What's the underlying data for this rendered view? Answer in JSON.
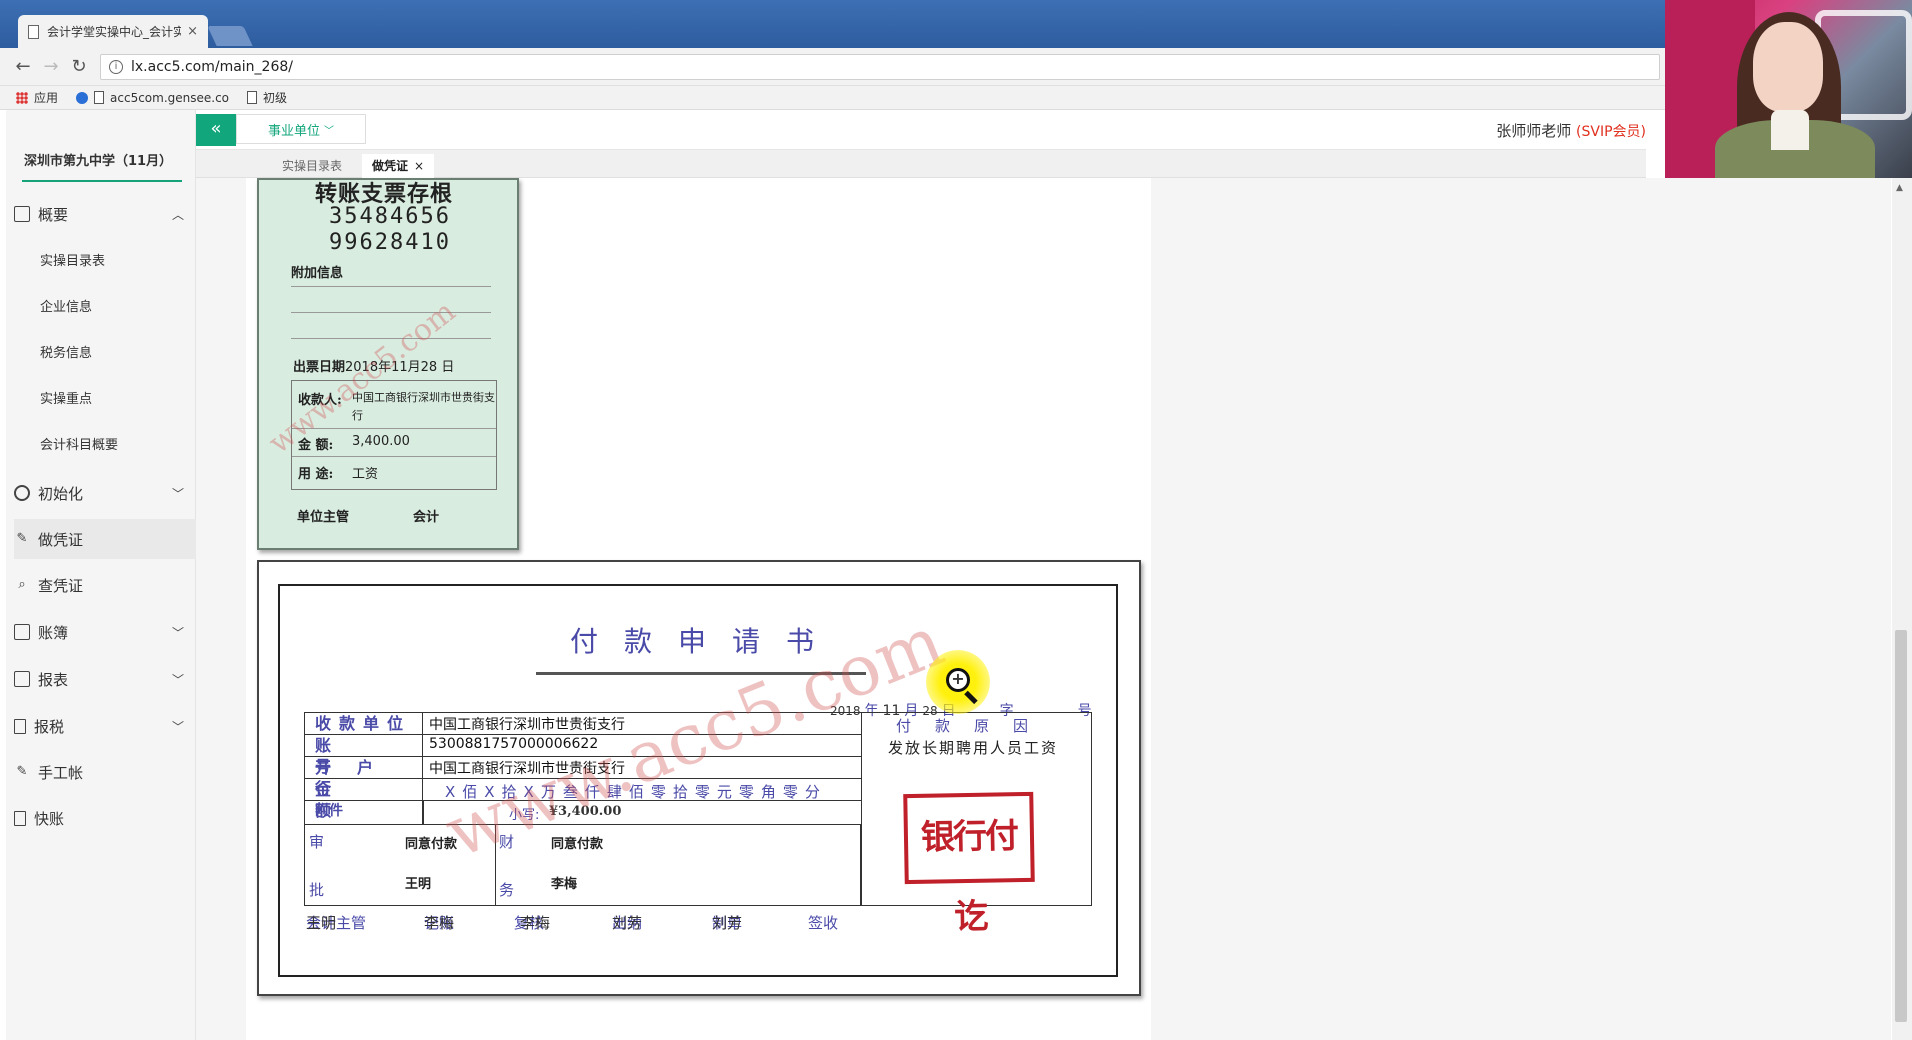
{
  "browser": {
    "tab_title": "会计学堂实操中心_会计实",
    "url": "lx.acc5.com/main_268/",
    "bookmarks": [
      "应用",
      "acc5com.gensee.co",
      "初级"
    ]
  },
  "app": {
    "unit_select": "事业单位",
    "user_name": "张师师老师",
    "user_badge": "(SVIP会员)",
    "tabs": [
      {
        "label": "实操目录表",
        "active": false
      },
      {
        "label": "做凭证",
        "active": true
      }
    ]
  },
  "sidebar": {
    "school": "深圳市第九中学（11月）",
    "menu": [
      {
        "label": "概要",
        "icon": "grid-icon",
        "expanded": true
      },
      {
        "label": "初始化",
        "icon": "gear-icon",
        "expanded": false
      },
      {
        "label": "做凭证",
        "icon": "pencil-icon",
        "active": true
      },
      {
        "label": "查凭证",
        "icon": "search-icon"
      },
      {
        "label": "账簿",
        "icon": "ledger-icon",
        "expanded": false
      },
      {
        "label": "报表",
        "icon": "report-icon",
        "expanded": false
      },
      {
        "label": "报税",
        "icon": "document-icon",
        "expanded": false
      },
      {
        "label": "手工帐",
        "icon": "pencil-icon"
      },
      {
        "label": "快账",
        "icon": "document-icon"
      }
    ],
    "submenu": [
      "实操目录表",
      "企业信息",
      "税务信息",
      "实操重点",
      "会计科目概要"
    ]
  },
  "stub": {
    "title": "转账支票存根",
    "numbers": [
      "35484656",
      "99628410"
    ],
    "extra_info_label": "附加信息",
    "issue_date_label": "出票日期",
    "issue_date": "2018年11月28 日",
    "payee_label": "收款人:",
    "payee": "中国工商银行深圳市世贵街支行",
    "amount_label": "金  额:",
    "amount": "3,400.00",
    "purpose_label": "用  途:",
    "purpose": "工资",
    "supervisor_label": "单位主管",
    "accountant_label": "会计",
    "watermark": "www.acc5.com"
  },
  "payment_form": {
    "title": "付款申请书",
    "date_year": "2018",
    "date_month": "11",
    "date_day": "28",
    "date_labels": {
      "year": "年",
      "month": "月",
      "day": "日",
      "zi": "字",
      "hao": "号"
    },
    "fields": [
      {
        "label": "收款单位",
        "value": "中国工商银行深圳市世贵街支行"
      },
      {
        "label": "账号",
        "value": "5300881757000006622"
      },
      {
        "label": "开户行",
        "value": "中国工商银行深圳市世贵街支行"
      },
      {
        "label": "金额",
        "value": ""
      }
    ],
    "amount_digits": "X佰X拾X万叁仟肆佰零拾零元零角零分",
    "attachment_label": "附件",
    "small_amount_label": "小写:",
    "small_amount": "¥3,400.00",
    "reason_header": "付款原因",
    "reason": "发放长期聘用人员工资",
    "stamp": "银行付讫",
    "approval": {
      "shen_label": "审",
      "pi_label": "批",
      "cai_label": "财",
      "wu_label": "务",
      "approve_text": "同意付款",
      "approver": "王明",
      "finance_approve_text": "同意付款",
      "finance_approver": "李梅"
    },
    "footer": [
      {
        "label": "会计主管",
        "value": "王明"
      },
      {
        "label": "记账",
        "value": "李梅"
      },
      {
        "label": "复核",
        "value": "李梅"
      },
      {
        "label": "出纳",
        "value": "刘芳"
      },
      {
        "label": "制单",
        "value": "刘芳"
      },
      {
        "label": "签收",
        "value": ""
      }
    ],
    "watermark": "www.acc5.com"
  },
  "colors": {
    "accent": "#12a67c",
    "form_blue": "#4a4aa8",
    "stamp_red": "#c0202a",
    "vip_red": "#e0301e"
  }
}
